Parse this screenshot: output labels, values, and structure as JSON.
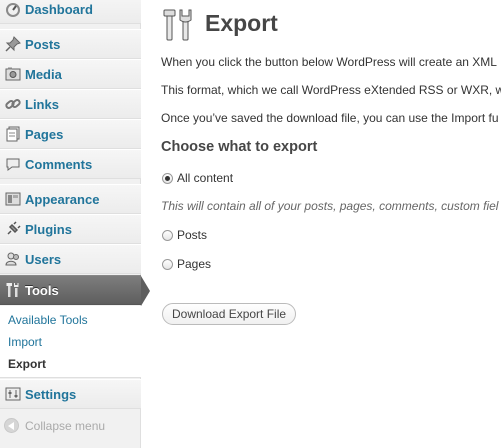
{
  "sidebar": {
    "items": [
      {
        "label": "Dashboard",
        "icon": "dashboard-icon"
      },
      {
        "label": "Posts",
        "icon": "pushpin-icon"
      },
      {
        "label": "Media",
        "icon": "media-icon"
      },
      {
        "label": "Links",
        "icon": "link-icon"
      },
      {
        "label": "Pages",
        "icon": "pages-icon"
      },
      {
        "label": "Comments",
        "icon": "comments-icon"
      },
      {
        "label": "Appearance",
        "icon": "appearance-icon"
      },
      {
        "label": "Plugins",
        "icon": "plugins-icon"
      },
      {
        "label": "Users",
        "icon": "users-icon"
      },
      {
        "label": "Tools",
        "icon": "tools-icon"
      },
      {
        "label": "Settings",
        "icon": "settings-icon"
      }
    ],
    "submenu": [
      "Available Tools",
      "Import",
      "Export"
    ],
    "collapse_label": "Collapse menu"
  },
  "main": {
    "title": "Export",
    "paragraphs": [
      "When you click the button below WordPress will create an XML",
      "This format, which we call WordPress eXtended RSS or WXR, w",
      "Once you’ve saved the download file, you can use the Import fu"
    ],
    "section_heading": "Choose what to export",
    "options": [
      {
        "label": "All content",
        "checked": true
      },
      {
        "label": "Posts",
        "checked": false
      },
      {
        "label": "Pages",
        "checked": false
      }
    ],
    "all_content_description": "This will contain all of your posts, pages, comments, custom fiel",
    "download_button": "Download Export File"
  },
  "colors": {
    "link": "#21759b",
    "current_menu_bg": "#5e5e5e",
    "sidebar_bg": "#f1f1f1"
  }
}
